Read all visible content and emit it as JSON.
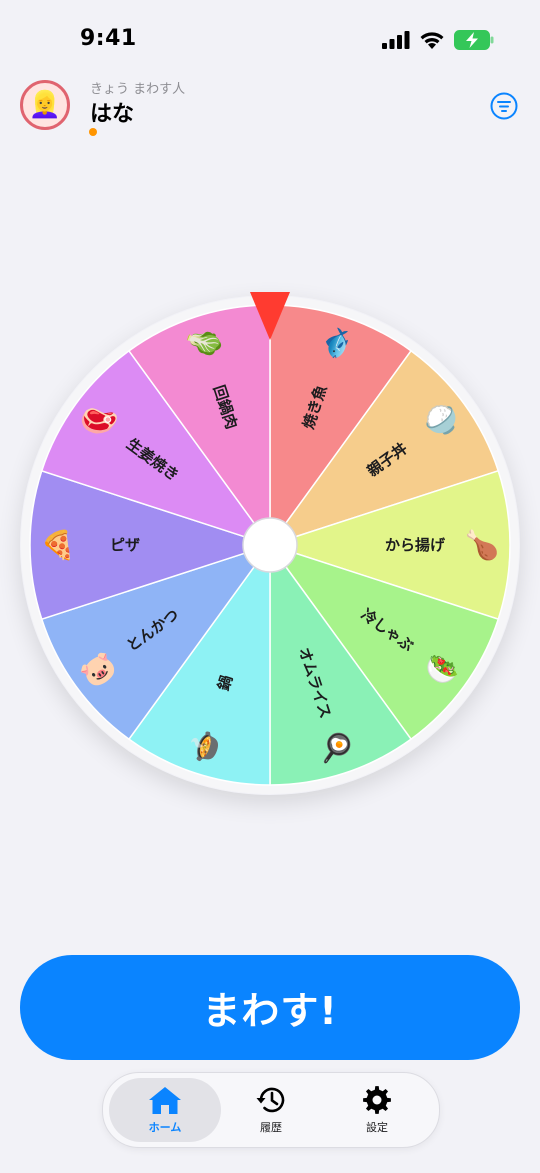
{
  "status_bar": {
    "time": "9:41"
  },
  "header": {
    "subtitle": "きょう まわす人",
    "user_name": "はな",
    "avatar_emoji": "👱‍♀️",
    "accent_color": "#0a84ff",
    "avatar_ring_color": "#e0646f",
    "status_dot_color": "#ff9500"
  },
  "wheel": {
    "segments": [
      {
        "label": "焼き魚",
        "emoji": "🐟",
        "color": "#f7898b"
      },
      {
        "label": "親子丼",
        "emoji": "🍚",
        "color": "#f6cd8c"
      },
      {
        "label": "から揚げ",
        "emoji": "🍗",
        "color": "#e2f58a"
      },
      {
        "label": "冷しゃぶ",
        "emoji": "🥗",
        "color": "#a7f38b"
      },
      {
        "label": "オムライス",
        "emoji": "🍳",
        "color": "#8af1b6"
      },
      {
        "label": "鍋",
        "emoji": "🍲",
        "color": "#8ef2f4"
      },
      {
        "label": "とんかつ",
        "emoji": "🐷",
        "color": "#8fb4f6"
      },
      {
        "label": "ピザ",
        "emoji": "🍕",
        "color": "#a18df2"
      },
      {
        "label": "生姜焼き",
        "emoji": "🥩",
        "color": "#dc8bf4"
      },
      {
        "label": "回鍋肉",
        "emoji": "🥬",
        "color": "#f38ad2"
      }
    ],
    "pointer_color": "#ff3b30"
  },
  "spin_button": {
    "label": "まわす!"
  },
  "tab_bar": {
    "tabs": [
      {
        "label": "ホーム",
        "icon": "house-icon",
        "active": true
      },
      {
        "label": "履歴",
        "icon": "history-icon",
        "active": false
      },
      {
        "label": "設定",
        "icon": "gear-icon",
        "active": false
      }
    ]
  }
}
